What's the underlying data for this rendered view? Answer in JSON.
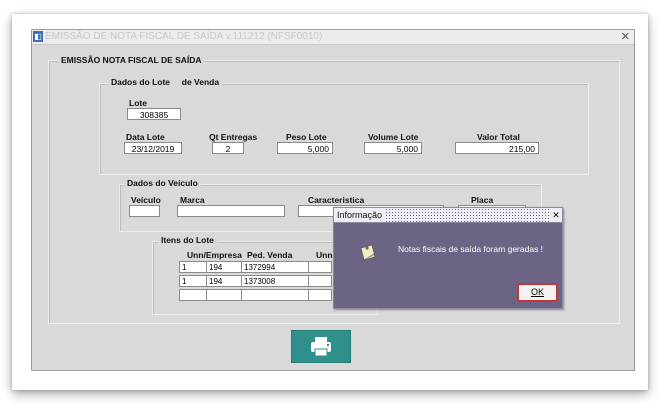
{
  "window": {
    "title": "EMISSÃO DE NOTA FISCAL DE SAÍDA v.111212 (NFSF0010)",
    "close_glyph": "✕",
    "app_icon": "app-icon"
  },
  "form": {
    "section_title": "EMISSÃO NOTA FISCAL DE SAÍDA",
    "lote_group": {
      "legend_part1": "Dados do Lote",
      "legend_part2": "de Venda",
      "lote_label": "Lote",
      "lote_value": "308385",
      "data_lote_label": "Data Lote",
      "data_lote_value": "23/12/2019",
      "qt_entregas_label": "Qt Entregas",
      "qt_entregas_value": "2",
      "peso_lote_label": "Peso Lote",
      "peso_lote_value": "5,000",
      "volume_lote_label": "Volume Lote",
      "volume_lote_value": "5,000",
      "valor_total_label": "Valor Total",
      "valor_total_value": "215,00"
    },
    "veiculo_group": {
      "legend": "Dados do Veículo",
      "veiculo_label": "Veículo",
      "veiculo_value": "",
      "marca_label": "Marca",
      "marca_value": "",
      "caracteristica_label": "Caracteristica",
      "caracteristica_value": "",
      "placa_label": "Placa",
      "placa_value": ""
    },
    "itens_group": {
      "legend": "Itens do Lote",
      "columns": [
        "Unn/Empresa",
        "Ped. Venda",
        "Unn"
      ],
      "rows": [
        {
          "unn": "1",
          "empresa": "194",
          "pedido": "1372994"
        },
        {
          "unn": "1",
          "empresa": "194",
          "pedido": "1373008"
        }
      ]
    },
    "print_button": {
      "icon": "printer-icon"
    }
  },
  "dialog": {
    "title": "Informação",
    "close_glyph": "✕",
    "message": "Notas fiscais de saída foram geradas !",
    "icon": "note-icon",
    "ok_label": "OK"
  },
  "colors": {
    "window_bg": "#d9d9d9",
    "dialog_bg": "#6d6385",
    "print_button": "#2f8f8a",
    "ok_focus_border": "#c8343c"
  }
}
